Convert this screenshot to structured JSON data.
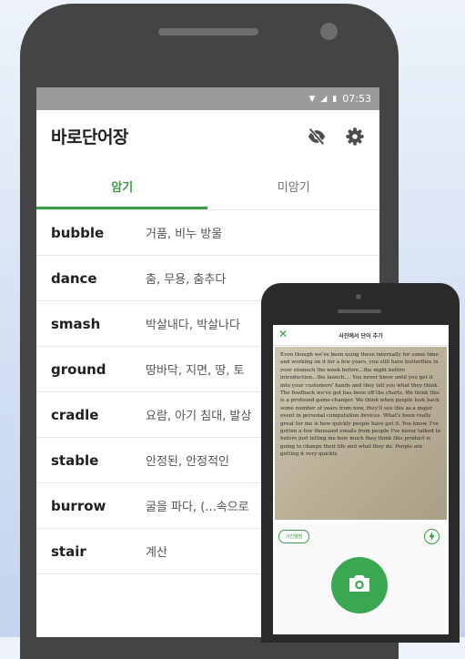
{
  "status_bar": {
    "time": "07:53"
  },
  "app": {
    "title": "바로단어장"
  },
  "icons": {
    "visibility_off": "eye-off-icon",
    "settings": "gear-icon",
    "close": "close-icon",
    "flash": "flash-icon",
    "camera": "camera-icon"
  },
  "tabs": [
    {
      "label": "암기"
    },
    {
      "label": "미암기"
    }
  ],
  "words": [
    {
      "word": "bubble",
      "meaning": "거품, 비누 방울"
    },
    {
      "word": "dance",
      "meaning": "춤, 무용, 춤추다"
    },
    {
      "word": "smash",
      "meaning": "박살내다, 박살나다"
    },
    {
      "word": "ground",
      "meaning": "땅바닥, 지면, 땅, 토"
    },
    {
      "word": "cradle",
      "meaning": "요람, 아기 침대, 발상"
    },
    {
      "word": "stable",
      "meaning": "안정된, 안정적인"
    },
    {
      "word": "burrow",
      "meaning": "굴을 파다, (...속으로"
    },
    {
      "word": "stair",
      "meaning": "계산"
    }
  ],
  "scan": {
    "title": "사진에서 단어 추가",
    "text": "Even though we've been using these internally for some time and working on it for a few years, you still have butterflies in your stomach the week before...the night before introduction...the launch.... You never know until you get it into your customers' hands and they tell you what they think. The feedback we've got has been off the charts. We think this is a profound game-changer. We think when people look back some number of years from now, they'll see this as a major event in personal computation devices. What's been really great for me is how quickly people have got it. You know, I've gotten a few thousand emails from people I've never talked to before just telling me how much they think this product is going to change their life and what they do. People are getting it very quickly.",
    "chip": "사진앨범"
  },
  "colors": {
    "accent": "#3a9b45",
    "status_bar": "#9a9a9a",
    "phone_body": "#444444"
  }
}
